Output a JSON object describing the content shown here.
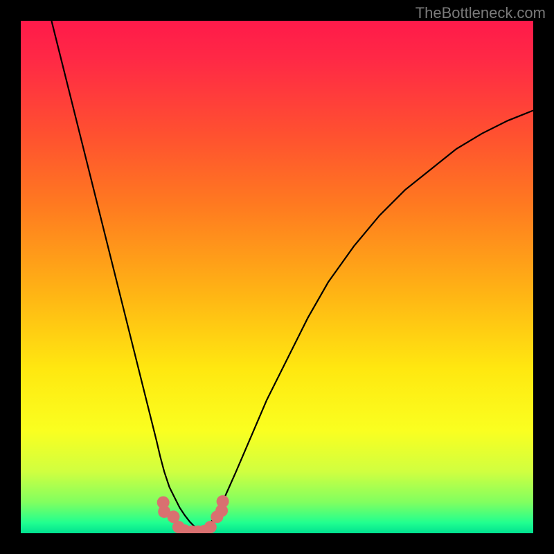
{
  "watermark": "TheBottleneck.com",
  "chart_data": {
    "type": "line",
    "title": "",
    "xlabel": "",
    "ylabel": "",
    "xlim": [
      0,
      100
    ],
    "ylim": [
      0,
      100
    ],
    "series": [
      {
        "name": "left-curve",
        "x": [
          6,
          8,
          10,
          12,
          14,
          16,
          18,
          20,
          22,
          24,
          25.5,
          26.5,
          27.2,
          28,
          29,
          30,
          31,
          32,
          33,
          34,
          35
        ],
        "y": [
          100,
          92,
          84,
          76,
          68,
          60,
          52,
          44,
          36,
          28,
          22,
          18,
          15,
          12,
          9,
          7,
          5,
          3.5,
          2.2,
          1.2,
          0.4
        ]
      },
      {
        "name": "right-curve",
        "x": [
          35,
          36,
          37,
          38,
          39,
          40,
          42,
          45,
          48,
          52,
          56,
          60,
          65,
          70,
          75,
          80,
          85,
          90,
          95,
          100
        ],
        "y": [
          0.4,
          1.0,
          2.0,
          3.4,
          5.2,
          7.5,
          12,
          19,
          26,
          34,
          42,
          49,
          56,
          62,
          67,
          71,
          75,
          78,
          80.5,
          82.5
        ]
      }
    ],
    "scatter": {
      "name": "bottom-dots",
      "x": [
        27.8,
        28.0,
        29.8,
        30.8,
        32.0,
        33.4,
        34.6,
        35.8,
        37.0,
        38.3,
        39.2,
        39.4
      ],
      "y": [
        6.0,
        4.2,
        3.2,
        1.2,
        0.5,
        0.3,
        0.3,
        0.4,
        1.2,
        3.2,
        4.4,
        6.2
      ]
    },
    "gradient_stops": [
      {
        "pos": 0,
        "color": "#ff1a4a"
      },
      {
        "pos": 0.5,
        "color": "#ffe810"
      },
      {
        "pos": 1.0,
        "color": "#00e090"
      }
    ]
  }
}
